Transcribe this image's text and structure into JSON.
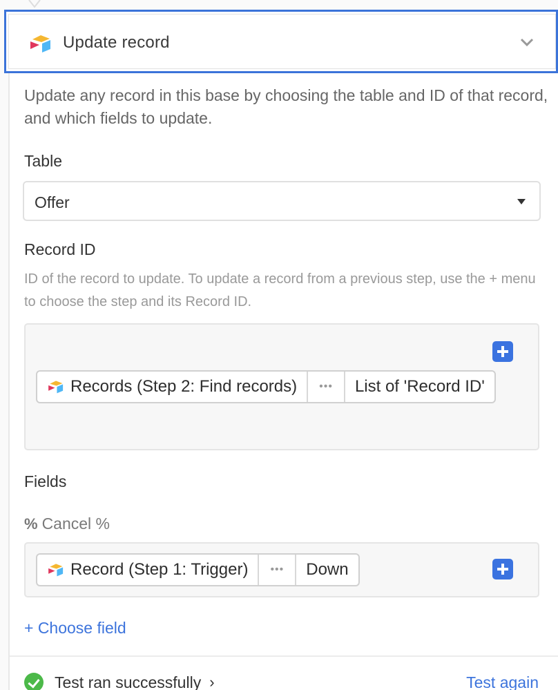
{
  "header": {
    "title": "Update record",
    "icon": "airtable-logo-icon",
    "toggle_icon": "chevron-down-icon"
  },
  "description": "Update any record in this base by choosing the table and ID of that record, and which fields to update.",
  "table": {
    "label": "Table",
    "selected": "Offer",
    "caret_icon": "caret-down-icon"
  },
  "record_id": {
    "label": "Record ID",
    "hint": "ID of the record to update. To update a record from a previous step, use the + menu to choose the step and its Record ID.",
    "token": {
      "source": "Records (Step 2: Find records)",
      "more": "•••",
      "field": "List of 'Record ID'"
    },
    "add_icon": "plus-icon"
  },
  "fields": {
    "label": "Fields",
    "items": [
      {
        "name": "Cancel %",
        "type_icon": "%",
        "token": {
          "source": "Record (Step 1: Trigger)",
          "more": "•••",
          "field": "Down"
        }
      }
    ],
    "choose_label": "+ Choose field"
  },
  "footer": {
    "status": "Test ran successfully",
    "status_arrow": "›",
    "test_again": "Test again"
  },
  "colors": {
    "accent": "#3b73e0",
    "success": "#4cb949",
    "link": "#3d74dc"
  }
}
